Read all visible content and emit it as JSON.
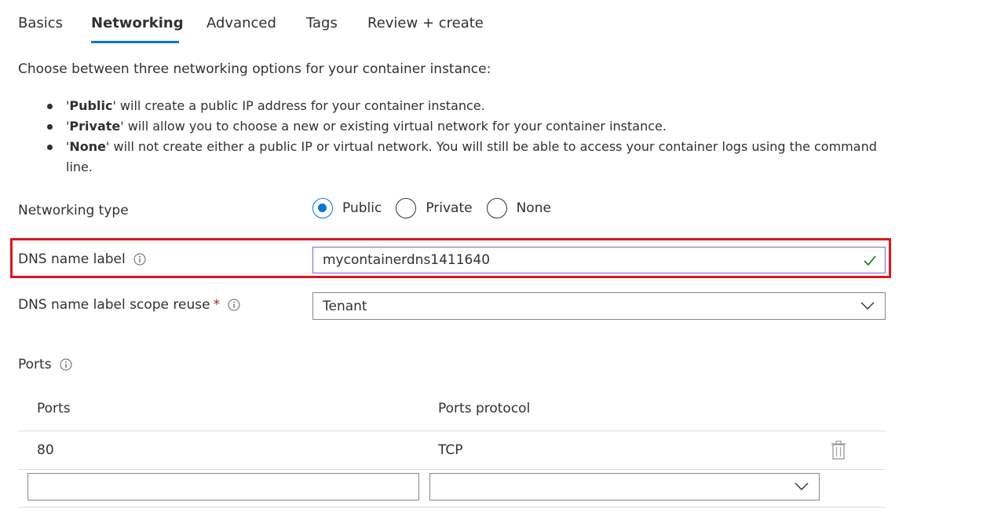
{
  "tabs": [
    {
      "label": "Basics"
    },
    {
      "label": "Networking",
      "active": true
    },
    {
      "label": "Advanced"
    },
    {
      "label": "Tags"
    },
    {
      "label": "Review + create"
    }
  ],
  "intro": "Choose between three networking options for your container instance:",
  "bullets": [
    {
      "bold": "Public",
      "rest": "' will create a public IP address for your container instance."
    },
    {
      "bold": "Private",
      "rest": "' will allow you to choose a new or existing virtual network for your container instance."
    },
    {
      "bold": "None",
      "rest": "' will not create either a public IP or virtual network. You will still be able to access your container logs using the command line."
    }
  ],
  "networking_type": {
    "label": "Networking type",
    "options": [
      "Public",
      "Private",
      "None"
    ],
    "selected": "Public"
  },
  "dns_name_label": {
    "label": "DNS name label",
    "value": "mycontainerdns1411640"
  },
  "dns_scope_reuse": {
    "label": "DNS name label scope reuse",
    "required_mark": "*",
    "value": "Tenant"
  },
  "ports_section": {
    "label": "Ports",
    "columns": [
      "Ports",
      "Ports protocol"
    ],
    "rows": [
      {
        "port": "80",
        "protocol": "TCP"
      }
    ],
    "new_row": {
      "port": "",
      "protocol": ""
    }
  },
  "colors": {
    "accent": "#0078d4",
    "highlight": "#e0141e",
    "success": "#107c10",
    "required": "#a4262c"
  },
  "icons": [
    "info-icon",
    "checkmark-icon",
    "chevron-down-icon",
    "trash-icon"
  ]
}
